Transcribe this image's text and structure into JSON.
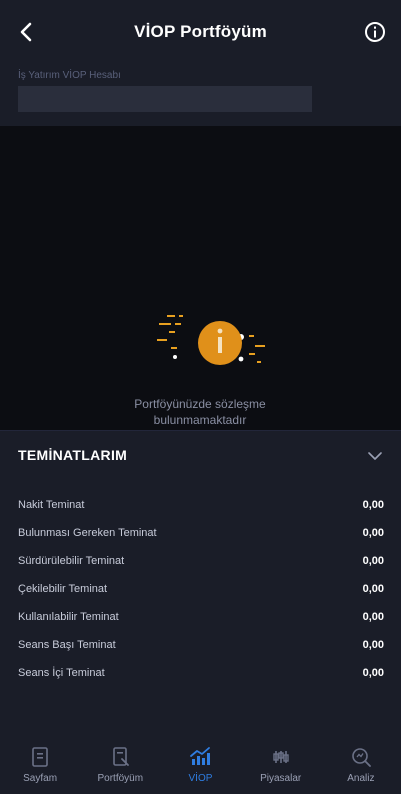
{
  "header": {
    "title": "VİOP Portföyüm"
  },
  "account": {
    "label": "İş Yatırım VİOP Hesabı"
  },
  "empty_state": {
    "message": "Portföyünüzde sözleşme bulunmamaktadır"
  },
  "collateral": {
    "title": "TEMİNATLARIM",
    "rows": [
      {
        "label": "Nakit Teminat",
        "value": "0,00"
      },
      {
        "label": "Bulunması Gereken Teminat",
        "value": "0,00"
      },
      {
        "label": "Sürdürülebilir Teminat",
        "value": "0,00"
      },
      {
        "label": "Çekilebilir Teminat",
        "value": "0,00"
      },
      {
        "label": "Kullanılabilir Teminat",
        "value": "0,00"
      },
      {
        "label": "Seans Başı Teminat",
        "value": "0,00"
      },
      {
        "label": "Seans İçi Teminat",
        "value": "0,00"
      }
    ]
  },
  "tabs": [
    {
      "label": "Sayfam",
      "icon": "page-icon",
      "active": false
    },
    {
      "label": "Portföyüm",
      "icon": "portfolio-icon",
      "active": false
    },
    {
      "label": "VİOP",
      "icon": "viop-chart-icon",
      "active": true
    },
    {
      "label": "Piyasalar",
      "icon": "markets-icon",
      "active": false
    },
    {
      "label": "Analiz",
      "icon": "analysis-icon",
      "active": false
    }
  ],
  "colors": {
    "accent": "#2f7de1",
    "warning": "#e8a020",
    "background": "#0c0d12",
    "panel": "#1a1d28"
  }
}
